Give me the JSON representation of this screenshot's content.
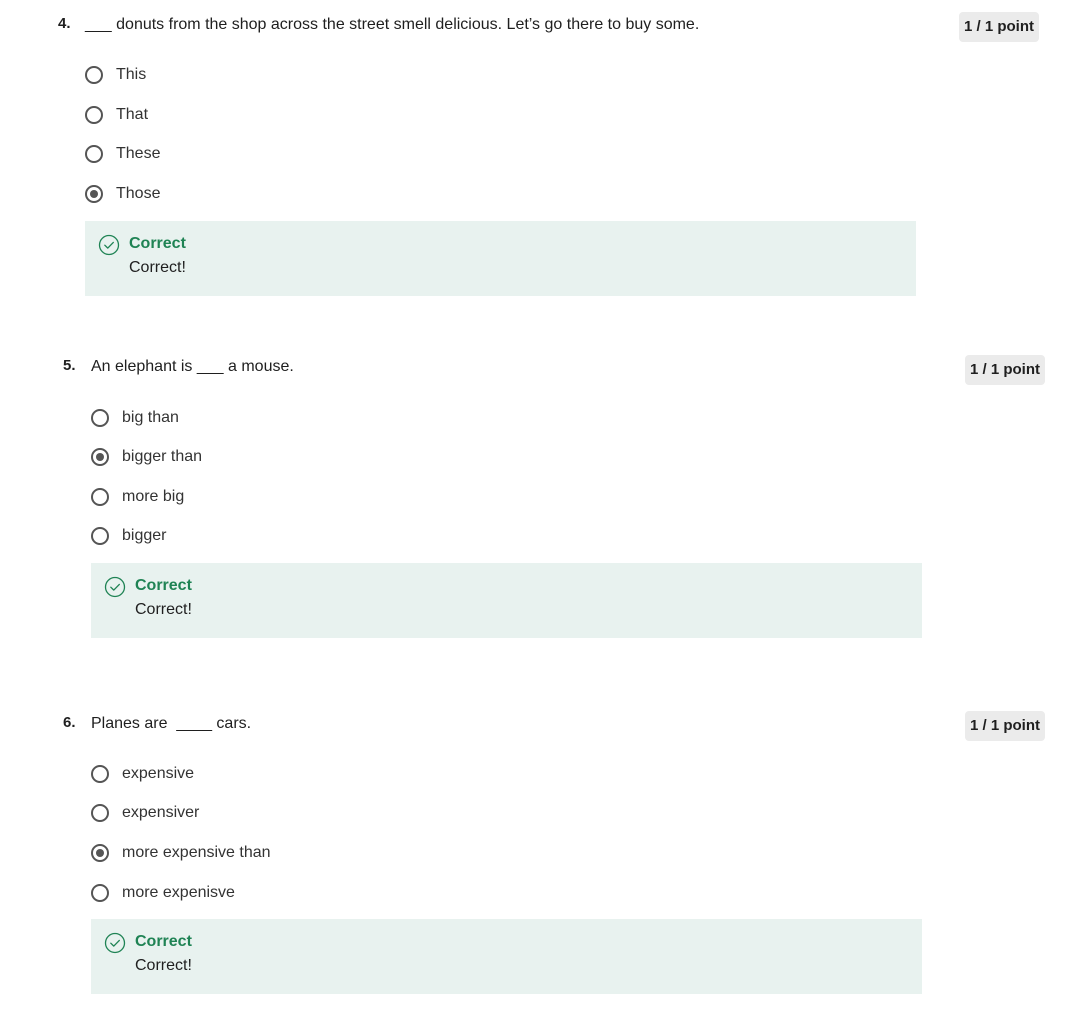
{
  "questions": [
    {
      "number": "4.",
      "text": "___ donuts from the shop across the street smell delicious. Let’s go there to buy some.",
      "points": "1 / 1 point",
      "options": [
        {
          "label": "This",
          "selected": false
        },
        {
          "label": "That",
          "selected": false
        },
        {
          "label": "These",
          "selected": false
        },
        {
          "label": "Those",
          "selected": true
        }
      ],
      "feedback": {
        "title": "Correct",
        "text": "Correct!"
      }
    },
    {
      "number": "5.",
      "text": "An elephant is ___ a mouse.",
      "points": "1 / 1 point",
      "options": [
        {
          "label": "big than",
          "selected": false
        },
        {
          "label": "bigger than",
          "selected": true
        },
        {
          "label": "more big",
          "selected": false
        },
        {
          "label": "bigger",
          "selected": false
        }
      ],
      "feedback": {
        "title": "Correct",
        "text": "Correct!"
      }
    },
    {
      "number": "6.",
      "text": "Planes are  ____ cars.",
      "points": "1 / 1 point",
      "options": [
        {
          "label": "expensive",
          "selected": false
        },
        {
          "label": "expensiver",
          "selected": false
        },
        {
          "label": "more expensive than",
          "selected": true
        },
        {
          "label": "more expenisve",
          "selected": false
        }
      ],
      "feedback": {
        "title": "Correct",
        "text": "Correct!"
      }
    }
  ],
  "colors": {
    "correct_text": "#1f8354",
    "feedback_bg": "#e8f2ef",
    "points_bg": "#ebebeb"
  },
  "icons": {
    "feedback": "check-circle-icon",
    "radio": "radio-button-icon"
  }
}
